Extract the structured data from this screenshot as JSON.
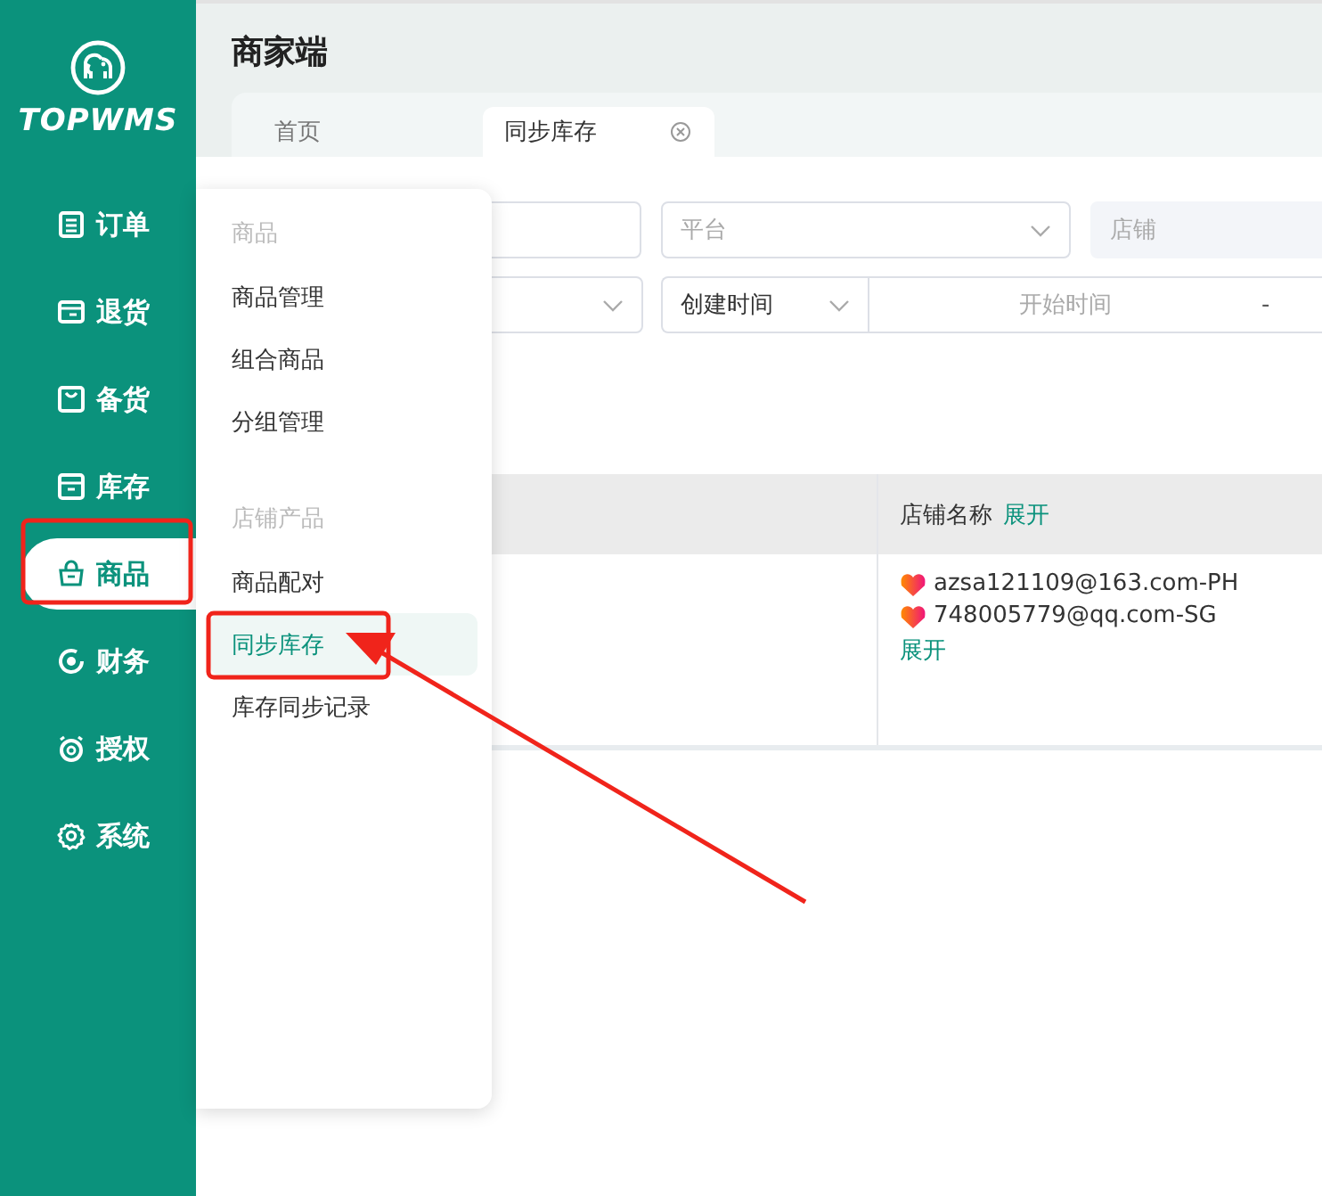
{
  "app": {
    "logo": "TOPWMS",
    "title": "商家端"
  },
  "sidebar": {
    "items": [
      {
        "label": "订单",
        "selected": false
      },
      {
        "label": "退货",
        "selected": false
      },
      {
        "label": "备货",
        "selected": false
      },
      {
        "label": "库存",
        "selected": false
      },
      {
        "label": "商品",
        "selected": true
      },
      {
        "label": "财务",
        "selected": false
      },
      {
        "label": "授权",
        "selected": false
      },
      {
        "label": "系统",
        "selected": false
      }
    ]
  },
  "tabs": [
    {
      "label": "首页",
      "selected": false,
      "closable": false
    },
    {
      "label": "同步库存",
      "selected": true,
      "closable": true
    }
  ],
  "filters": {
    "platform": {
      "placeholder": "平台"
    },
    "shop": {
      "placeholder": "店铺",
      "disabled": true
    },
    "time_type": {
      "value": "创建时间"
    },
    "date_range": {
      "start_placeholder": "开始时间",
      "separator": "-"
    }
  },
  "table": {
    "columns": [
      {
        "title": "店铺名称",
        "action": "展开"
      }
    ],
    "rows": [
      {
        "shops": [
          "azsa121109@163.com-PH",
          "748005779@qq.com-SG"
        ],
        "more": "展开"
      }
    ]
  },
  "menu": {
    "groups": [
      {
        "title": "商品",
        "items": [
          {
            "label": "商品管理",
            "selected": false
          },
          {
            "label": "组合商品",
            "selected": false
          },
          {
            "label": "分组管理",
            "selected": false
          }
        ]
      },
      {
        "title": "店铺产品",
        "items": [
          {
            "label": "商品配对",
            "selected": false
          },
          {
            "label": "同步库存",
            "selected": true
          },
          {
            "label": "库存同步记录",
            "selected": false
          }
        ]
      }
    ]
  }
}
